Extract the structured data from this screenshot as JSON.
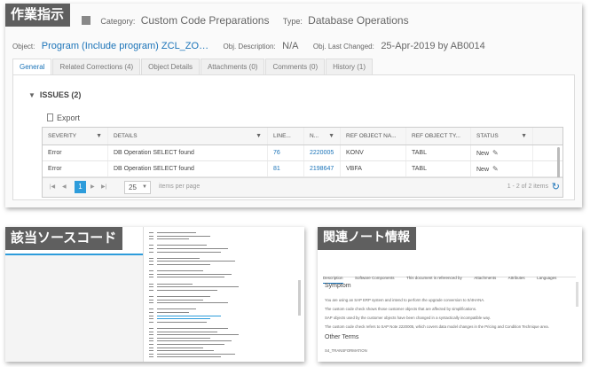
{
  "main": {
    "tag": "作業指示",
    "category_label": "Category:",
    "category_value": "Custom Code Preparations",
    "type_label": "Type:",
    "type_value": "Database Operations",
    "object_label": "Object:",
    "object_value": "Program (Include program) ZCL_ZO…",
    "obj_desc_label": "Obj. Description:",
    "obj_desc_value": "N/A",
    "obj_last_changed_label": "Obj. Last Changed:",
    "obj_last_changed_value": "25-Apr-2019 by AB0014",
    "tabs": [
      {
        "label": "General"
      },
      {
        "label": "Related Corrections (4)"
      },
      {
        "label": "Object Details"
      },
      {
        "label": "Attachments (0)"
      },
      {
        "label": "Comments (0)"
      },
      {
        "label": "History (1)"
      }
    ],
    "issues_title": "ISSUES (2)",
    "export_label": "Export",
    "columns": {
      "severity": "SEVERITY",
      "details": "DETAILS",
      "line": "LINE...",
      "n": "N...",
      "ref_name": "REF OBJECT NA...",
      "ref_type": "REF OBJECT TY...",
      "status": "STATUS"
    },
    "rows": [
      {
        "severity": "Error",
        "details": "DB Operation SELECT found",
        "line": "76",
        "n": "2220005",
        "ref_name": "KONV",
        "ref_type": "TABL",
        "status": "New"
      },
      {
        "severity": "Error",
        "details": "DB Operation SELECT found",
        "line": "81",
        "n": "2198647",
        "ref_name": "VBFA",
        "ref_type": "TABL",
        "status": "New"
      }
    ],
    "pager": {
      "page": "1",
      "page_size": "25",
      "items_per_page": "items per page",
      "info": "1 - 2 of 2 items"
    }
  },
  "source": {
    "tag": "該当ソースコード"
  },
  "note": {
    "tag": "関連ノート情報",
    "tabs": [
      {
        "label": "Description"
      },
      {
        "label": "Software Components"
      },
      {
        "label": "This document is referenced by"
      },
      {
        "label": "Attachments"
      },
      {
        "label": "Attributes"
      },
      {
        "label": "Languages"
      }
    ],
    "symptom_heading": "Symptom",
    "paragraphs": [
      "You are using an SAP ERP system and intend to perform the upgrade conversion to S/4HANA.",
      "The custom code check shows those customer objects that are affected by simplifications.",
      "SAP objects used by the customer objects have been changed in a syntactically incompatible way.",
      "The custom code check refers to SAP Note 2220005, which covers data model changes in the Pricing and Condition Technique area."
    ],
    "other_terms_heading": "Other Terms",
    "other_terms_text": "S4_TRANSFORMATION"
  }
}
